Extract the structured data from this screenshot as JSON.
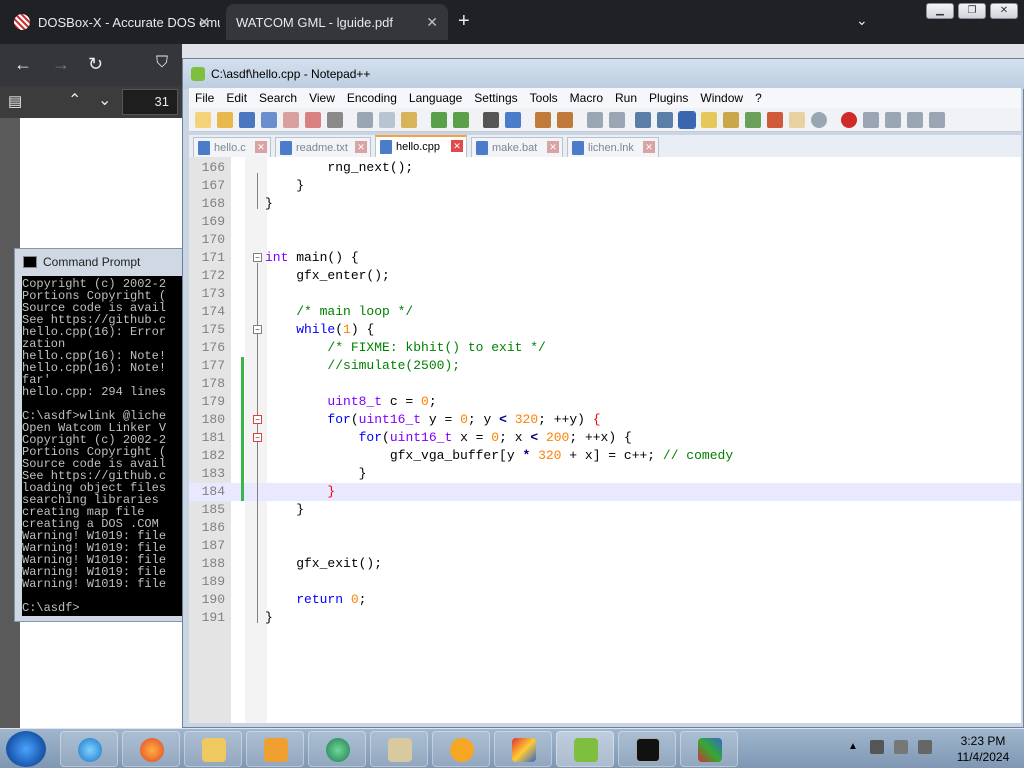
{
  "browser": {
    "tabs": [
      {
        "title": "DOSBox-X - Accurate DOS emu"
      },
      {
        "title": "WATCOM GML - lguide.pdf"
      }
    ],
    "page_number": "31"
  },
  "cmd": {
    "title": "Command Prompt",
    "lines": [
      "Copyright (c) 2002-2",
      "Portions Copyright (",
      "Source code is avail",
      "See https://github.c",
      "hello.cpp(16): Error",
      "zation",
      "hello.cpp(16): Note!",
      "hello.cpp(16): Note!",
      "far'",
      "hello.cpp: 294 lines",
      "",
      "C:\\asdf>wlink @liche",
      "Open Watcom Linker V",
      "Copyright (c) 2002-2",
      "Portions Copyright (",
      "Source code is avail",
      "See https://github.c",
      "loading object files",
      "searching libraries",
      "creating map file",
      "creating a DOS .COM",
      "Warning! W1019: file",
      "Warning! W1019: file",
      "Warning! W1019: file",
      "Warning! W1019: file",
      "Warning! W1019: file",
      "",
      "C:\\asdf>"
    ]
  },
  "npp": {
    "title": "C:\\asdf\\hello.cpp - Notepad++",
    "menu": [
      "File",
      "Edit",
      "Search",
      "View",
      "Encoding",
      "Language",
      "Settings",
      "Tools",
      "Macro",
      "Run",
      "Plugins",
      "Window",
      "?"
    ],
    "tabs": [
      {
        "label": "hello.c",
        "active": false
      },
      {
        "label": "readme.txt",
        "active": false
      },
      {
        "label": "hello.cpp",
        "active": true
      },
      {
        "label": "make.bat",
        "active": false
      },
      {
        "label": "lichen.lnk",
        "active": false
      }
    ],
    "code_lines": [
      {
        "n": "166",
        "html": "        rng_next();"
      },
      {
        "n": "167",
        "html": "    }"
      },
      {
        "n": "168",
        "html": "}"
      },
      {
        "n": "169",
        "html": ""
      },
      {
        "n": "170",
        "html": ""
      },
      {
        "n": "171",
        "html": "<span class=\"ty\">int</span> main() {"
      },
      {
        "n": "172",
        "html": "    gfx_enter();"
      },
      {
        "n": "173",
        "html": ""
      },
      {
        "n": "174",
        "html": "    <span class=\"cm\">/* main loop */</span>"
      },
      {
        "n": "175",
        "html": "    <span class=\"kw\">while</span>(<span class=\"nu\">1</span>) {"
      },
      {
        "n": "176",
        "html": "        <span class=\"cm\">/* FIXME: kbhit() to exit */</span>"
      },
      {
        "n": "177",
        "html": "        <span class=\"cm\">//simulate(2500);</span>"
      },
      {
        "n": "178",
        "html": ""
      },
      {
        "n": "179",
        "html": "        <span class=\"ty\">uint8_t</span> c = <span class=\"nu\">0</span>;"
      },
      {
        "n": "180",
        "html": "        <span class=\"kw\">for</span>(<span class=\"ty\">uint16_t</span> y = <span class=\"nu\">0</span>; y <span class=\"op\">&lt;</span> <span class=\"nu\">320</span>; ++y) <span class=\"br\">{</span>"
      },
      {
        "n": "181",
        "html": "            <span class=\"kw\">for</span>(<span class=\"ty\">uint16_t</span> x = <span class=\"nu\">0</span>; x <span class=\"op\">&lt;</span> <span class=\"nu\">200</span>; ++x) {"
      },
      {
        "n": "182",
        "html": "                gfx_vga_buffer[y <span class=\"op\">*</span> <span class=\"nu\">320</span> + x] = c++; <span class=\"cm\">// comedy</span>"
      },
      {
        "n": "183",
        "html": "            }"
      },
      {
        "n": "184",
        "html": "        <span class=\"br\">}</span>"
      },
      {
        "n": "185",
        "html": "    }"
      },
      {
        "n": "186",
        "html": ""
      },
      {
        "n": "187",
        "html": ""
      },
      {
        "n": "188",
        "html": "    gfx_exit();"
      },
      {
        "n": "189",
        "html": ""
      },
      {
        "n": "190",
        "html": "    <span class=\"kw\">return</span> <span class=\"nu\">0</span>;"
      },
      {
        "n": "191",
        "html": "}"
      }
    ]
  },
  "taskbar": {
    "time": "3:23 PM",
    "date": "11/4/2024"
  },
  "colors": {
    "accent": "#f4a340",
    "changed_marker": "#3ab54a"
  }
}
